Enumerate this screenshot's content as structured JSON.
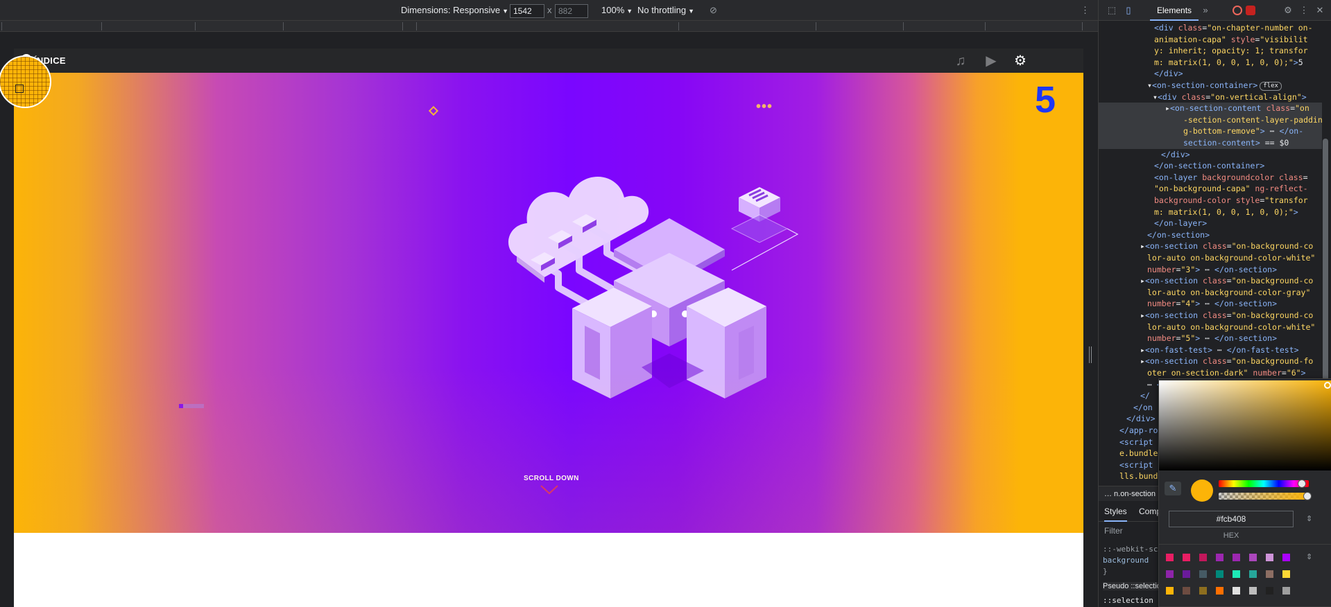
{
  "device_toolbar": {
    "dimensions_label": "Dimensions: Responsive",
    "width": "1542",
    "height_placeholder": "882",
    "times": "x",
    "zoom": "100%",
    "throttling": "No throttling"
  },
  "app_header": {
    "menu_label": "ÍNDICE"
  },
  "hero": {
    "chapter_number": "5",
    "dots": "•••",
    "scroll_label": "SCROLL DOWN"
  },
  "devtools": {
    "tab_elements": "Elements",
    "dom_lines": [
      {
        "indent": 80,
        "html": "<span class='tag'>&lt;div</span> <span class='attr'>class</span>=<span class='val'>\"on-chapter-number on-</span>"
      },
      {
        "indent": 80,
        "html": "<span class='val'>animation-capa\"</span> <span class='attr'>style</span>=<span class='val'>\"visibilit</span>"
      },
      {
        "indent": 80,
        "html": "<span class='val'>y: inherit; opacity: 1; transfor</span>"
      },
      {
        "indent": 80,
        "html": "<span class='val'>m: matrix(1, 0, 0, 1, 0, 0);\"</span><span class='tag'>&gt;</span><span class='txt'>5</span>"
      },
      {
        "indent": 80,
        "html": "<span class='tag'>&lt;/div&gt;</span>"
      },
      {
        "indent": 70,
        "html": "<span class='txt'>▾</span><span class='tag'>&lt;on-section-container&gt;</span><span class='flexbadge'>flex</span>"
      },
      {
        "indent": 78,
        "html": "<span class='txt'>▾</span><span class='tag'>&lt;div</span> <span class='attr'>class</span>=<span class='val'>\"on-vertical-align\"</span><span class='tag'>&gt;</span>"
      },
      {
        "indent": 96,
        "html": "<span class='txt'>▸</span><span class='tag'>&lt;on-section-content</span> <span class='attr'>class</span>=<span class='val'>\"on</span>",
        "selected": true
      },
      {
        "indent": 122,
        "html": "<span class='val'>-section-content-layer-paddin</span>",
        "selected": true
      },
      {
        "indent": 122,
        "html": "<span class='val'>g-bottom-remove\"</span><span class='tag'>&gt;</span> <span class='txt'>⋯</span> <span class='tag'>&lt;/on-</span>",
        "selected": true
      },
      {
        "indent": 122,
        "html": "<span class='tag'>section-content&gt;</span> <span class='txt'>== $0</span>",
        "selected": true
      },
      {
        "indent": 90,
        "html": "<span class='tag'>&lt;/div&gt;</span>"
      },
      {
        "indent": 80,
        "html": "<span class='tag'>&lt;/on-section-container&gt;</span>"
      },
      {
        "indent": 80,
        "html": "<span class='tag'>&lt;on-layer</span> <span class='attr'>backgroundcolor class</span>="
      },
      {
        "indent": 80,
        "html": "<span class='val'>\"on-background-capa\"</span> <span class='attr'>ng-reflect-</span>"
      },
      {
        "indent": 80,
        "html": "<span class='attr'>background-color</span> <span class='attr'>style</span>=<span class='val'>\"transfor</span>"
      },
      {
        "indent": 80,
        "html": "<span class='val'>m: matrix(1, 0, 0, 1, 0, 0);\"</span><span class='tag'>&gt;</span>"
      },
      {
        "indent": 80,
        "html": "<span class='tag'>&lt;/on-layer&gt;</span>"
      },
      {
        "indent": 70,
        "html": "<span class='tag'>&lt;/on-section&gt;</span>"
      },
      {
        "indent": 60,
        "html": "<span class='txt'>▸</span><span class='tag'>&lt;on-section</span> <span class='attr'>class</span>=<span class='val'>\"on-background-co</span>"
      },
      {
        "indent": 70,
        "html": "<span class='val'>lor-auto on-background-color-white\"</span>"
      },
      {
        "indent": 70,
        "html": "<span class='attr'>number</span>=<span class='val'>\"3\"</span><span class='tag'>&gt;</span> <span class='txt'>⋯</span> <span class='tag'>&lt;/on-section&gt;</span>"
      },
      {
        "indent": 60,
        "html": "<span class='txt'>▸</span><span class='tag'>&lt;on-section</span> <span class='attr'>class</span>=<span class='val'>\"on-background-co</span>"
      },
      {
        "indent": 70,
        "html": "<span class='val'>lor-auto on-background-color-gray\"</span>"
      },
      {
        "indent": 70,
        "html": "<span class='attr'>number</span>=<span class='val'>\"4\"</span><span class='tag'>&gt;</span> <span class='txt'>⋯</span> <span class='tag'>&lt;/on-section&gt;</span>"
      },
      {
        "indent": 60,
        "html": "<span class='txt'>▸</span><span class='tag'>&lt;on-section</span> <span class='attr'>class</span>=<span class='val'>\"on-background-co</span>"
      },
      {
        "indent": 70,
        "html": "<span class='val'>lor-auto on-background-color-white\"</span>"
      },
      {
        "indent": 70,
        "html": "<span class='attr'>number</span>=<span class='val'>\"5\"</span><span class='tag'>&gt;</span> <span class='txt'>⋯</span> <span class='tag'>&lt;/on-section&gt;</span>"
      },
      {
        "indent": 60,
        "html": "<span class='txt'>▸</span><span class='tag'>&lt;on-fast-test&gt;</span> <span class='txt'>⋯</span> <span class='tag'>&lt;/on-fast-test&gt;</span>"
      },
      {
        "indent": 60,
        "html": "<span class='txt'>▸</span><span class='tag'>&lt;on-section</span> <span class='attr'>class</span>=<span class='val'>\"on-background-fo</span>"
      },
      {
        "indent": 70,
        "html": "<span class='val'>oter on-section-dark\"</span> <span class='attr'>number</span>=<span class='val'>\"6\"</span><span class='tag'>&gt;</span>"
      },
      {
        "indent": 70,
        "html": "<span class='txt'>⋯</span> <span class='tag'>&lt;/on-section&gt;</span>"
      },
      {
        "indent": 60,
        "html": "<span class='tag'>&lt;/</span>"
      },
      {
        "indent": 50,
        "html": "<span class='tag'>&lt;/on</span>"
      },
      {
        "indent": 40,
        "html": "<span class='tag'>&lt;/div&gt;</span>"
      },
      {
        "indent": 30,
        "html": "<span class='tag'>&lt;/app-ro</span>"
      },
      {
        "indent": 30,
        "html": "<span class='tag'>&lt;script</span>"
      },
      {
        "indent": 30,
        "html": "<span class='val'>e.bundle</span>"
      },
      {
        "indent": 30,
        "html": "<span class='tag'>&lt;script</span>"
      },
      {
        "indent": 30,
        "html": "<span class='val'>lls.bund</span>"
      }
    ],
    "breadcrumb": "… n.on-section",
    "styles_tab": "Styles",
    "computed_tab": "Comp",
    "filter_placeholder": "Filter",
    "rule_1_selector": "::-webkit-scr",
    "rule_1_prop": "  background",
    "rule_1_close": "}",
    "pseudo_label": "Pseudo ::selection",
    "rule_2_selector": "::selection {"
  },
  "color_picker": {
    "hex_value": "#fcb408",
    "format_label": "HEX",
    "selected_color": "#fcb408",
    "palette": [
      "#e91e63",
      "#e91e63",
      "#c2185b",
      "#9c27b0",
      "#9c27b0",
      "#ab47bc",
      "#ce93d8",
      "#aa00ff",
      "#8e24aa",
      "#6a1b9a",
      "#455a64",
      "#00897b",
      "#1de9b6",
      "#26a69a",
      "#8d6e63",
      "#fdd835",
      "#fcb408",
      "#6d4c41",
      "#8d6e1f",
      "#ff6f00",
      "#e0e0e0",
      "#bdbdbd",
      "#212121",
      "#9e9e9e"
    ]
  },
  "colors": {
    "accent": "#8ab4f8",
    "chapter_number": "#1d37f5",
    "hero_edge": "#fcb408",
    "hero_center": "#7a06ff"
  }
}
